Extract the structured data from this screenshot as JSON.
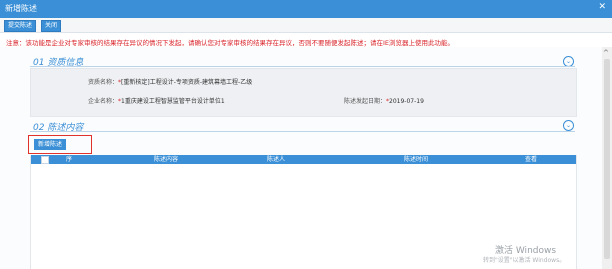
{
  "window": {
    "title": "新增陈述"
  },
  "toolbar": {
    "submit_label": "提交陈述",
    "close_label": "关闭"
  },
  "notice": "注意：该功能是企业对专家审核的结果存在异议的情况下发起，请确认您对专家审核的结果存在异议，否则不要随便发起陈述；请在IE浏览器上使用此功能。",
  "section1": {
    "number": "01",
    "title": "资质信息",
    "fields": {
      "qualification": {
        "label": "资质名称：",
        "required_mark": "*",
        "value": "[重新核定]工程设计-专项资质-建筑幕墙工程-乙级"
      },
      "company": {
        "label": "企业名称：",
        "required_mark": "*",
        "value": "1重庆建设工程智慧监管平台设计单位1"
      },
      "date": {
        "label": "陈述发起日期：",
        "required_mark": "*",
        "value": "2019-07-19"
      }
    }
  },
  "section2": {
    "number": "02",
    "title": "陈述内容",
    "add_button": "新增陈述",
    "table": {
      "headers": [
        "序",
        "陈述内容",
        "陈述人",
        "陈述时间",
        "查看"
      ]
    }
  },
  "watermark": {
    "line1": "激活 Windows",
    "line2": "转到\"设置\"以激活 Windows。"
  },
  "colors": {
    "accent": "#3a8fd6",
    "warning": "#d9232a"
  }
}
